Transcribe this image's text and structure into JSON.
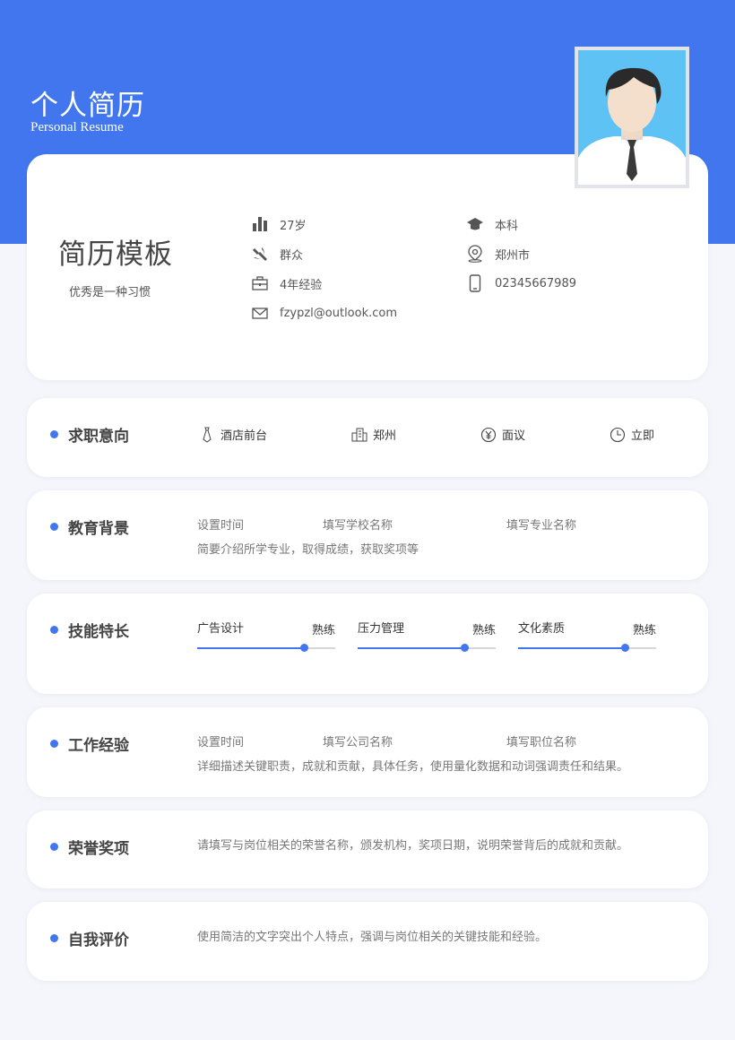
{
  "header": {
    "title": "个人简历",
    "subtitle": "Personal Resume"
  },
  "profile": {
    "name": "简历模板",
    "motto": "优秀是一种习惯",
    "age": "27岁",
    "politics": "群众",
    "experience": "4年经验",
    "email": "fzypzl@outlook.com",
    "education": "本科",
    "city": "郑州市",
    "phone": "02345667989"
  },
  "intent": {
    "title": "求职意向",
    "position": "酒店前台",
    "city": "郑州",
    "salary": "面议",
    "availability": "立即"
  },
  "education": {
    "title": "教育背景",
    "time": "设置时间",
    "school": "填写学校名称",
    "major": "填写专业名称",
    "desc": "简要介绍所学专业，取得成绩，获取奖项等"
  },
  "skills": {
    "title": "技能特长",
    "items": [
      {
        "name": "广告设计",
        "level": "熟练",
        "progress": 0.77
      },
      {
        "name": "压力管理",
        "level": "熟练",
        "progress": 0.77
      },
      {
        "name": "文化素质",
        "level": "熟练",
        "progress": 0.77
      }
    ]
  },
  "work": {
    "title": "工作经验",
    "time": "设置时间",
    "company": "填写公司名称",
    "position": "填写职位名称",
    "desc": "详细描述关键职责，成就和贡献，具体任务，使用量化数据和动词强调责任和结果。"
  },
  "honors": {
    "title": "荣誉奖项",
    "desc": "请填写与岗位相关的荣誉名称，颁发机构，奖项日期，说明荣誉背后的成就和贡献。"
  },
  "self_eval": {
    "title": "自我评价",
    "desc": "使用简洁的文字突出个人特点，强调与岗位相关的关键技能和经验。"
  },
  "colors": {
    "accent": "#4176ef",
    "background": "#f5f6fb",
    "card": "#ffffff"
  },
  "icons": [
    "bar-chart-icon",
    "hammer-sickle-icon",
    "briefcase-icon",
    "envelope-icon",
    "graduation-cap-icon",
    "location-pin-icon",
    "phone-icon",
    "tie-icon",
    "building-icon",
    "yen-icon",
    "clock-icon"
  ]
}
